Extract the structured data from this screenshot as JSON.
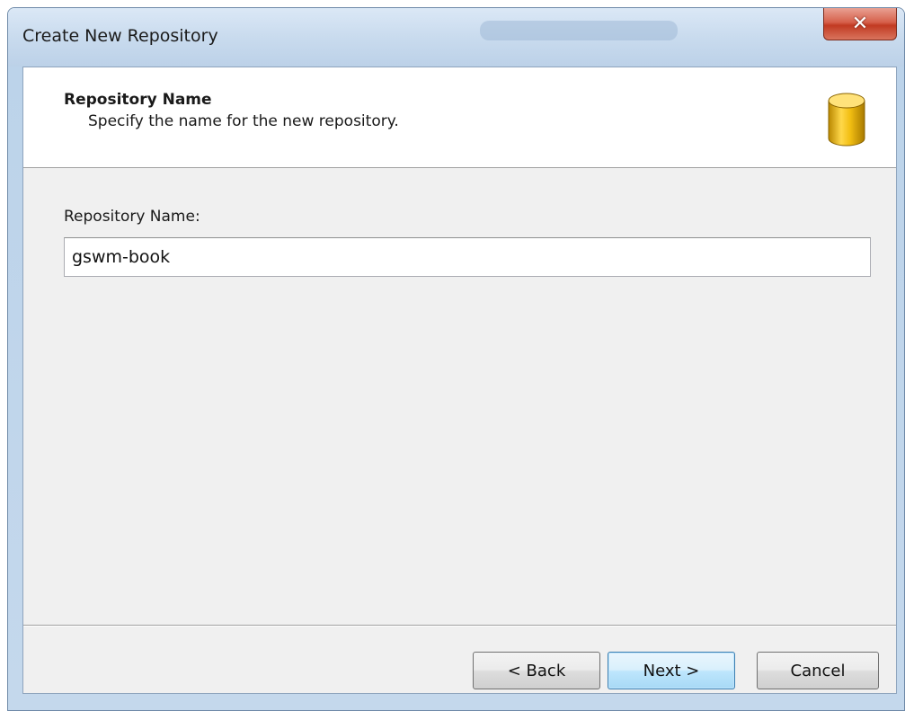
{
  "window": {
    "title": "Create New Repository",
    "close_glyph": "✕"
  },
  "header": {
    "title": "Repository Name",
    "subtitle": "Specify the name for the new repository.",
    "icon": "database-icon"
  },
  "form": {
    "label": "Repository Name:",
    "value": "gswm-book"
  },
  "buttons": {
    "back": "< Back",
    "next": "Next >",
    "cancel": "Cancel"
  },
  "colors": {
    "close_button": "#c13a22",
    "default_button_border": "#3c7fb1",
    "db_icon_gold": "#e8b300"
  }
}
